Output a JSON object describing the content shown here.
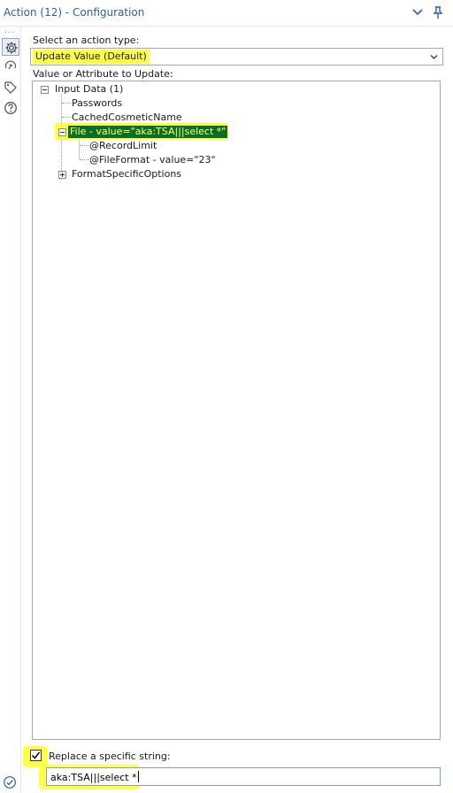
{
  "window": {
    "title": "Action (12) - Configuration",
    "chevron_icon": "chevron-down-icon",
    "pin_icon": "pin-icon"
  },
  "sidebar": {
    "dots": "...",
    "items": [
      {
        "icon": "gear-icon",
        "active": true
      },
      {
        "icon": "connection-icon",
        "active": false
      },
      {
        "icon": "tag-icon",
        "active": false
      },
      {
        "icon": "help-icon",
        "active": false
      }
    ],
    "bottom_icon": "check-circle-icon"
  },
  "action_type": {
    "label": "Select an action type:",
    "selected": "Update Value (Default)"
  },
  "tree": {
    "label": "Value or Attribute to Update:",
    "root": "Input Data (1)",
    "children": [
      "Passwords",
      "CachedCosmeticName"
    ],
    "selected": "File - value=\"aka:TSA|||select *\"",
    "selected_children": [
      "@RecordLimit",
      "@FileFormat - value=\"23\""
    ],
    "collapsed": "FormatSpecificOptions"
  },
  "replace": {
    "label": "Replace a specific string:",
    "checked": true,
    "value": "aka:TSA|||select *"
  },
  "colors": {
    "highlight": "#ffff44",
    "selected_bg": "#0a6d2a",
    "selected_text": "#ffff66",
    "title_text": "#2a5fa8"
  }
}
